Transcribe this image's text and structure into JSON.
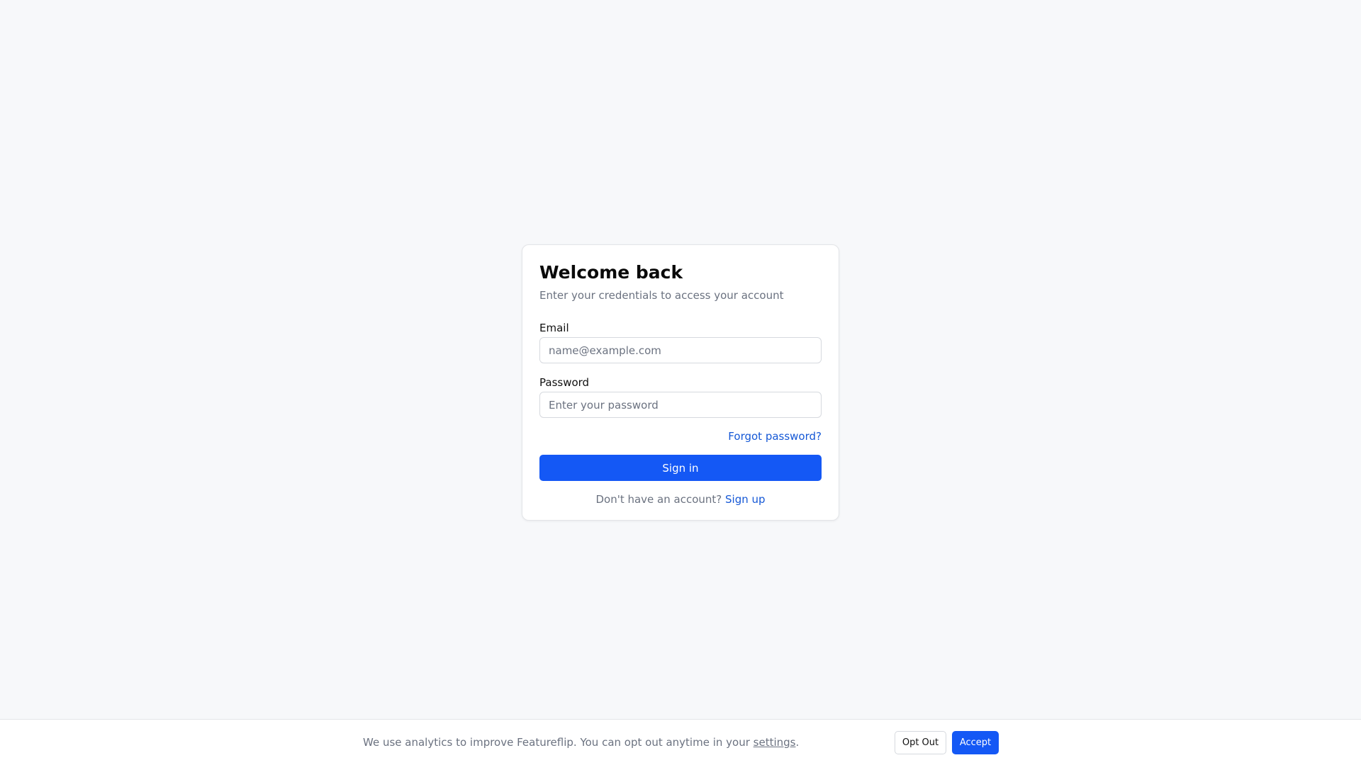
{
  "login": {
    "title": "Welcome back",
    "subtitle": "Enter your credentials to access your account",
    "email_label": "Email",
    "email_placeholder": "name@example.com",
    "email_value": "",
    "password_label": "Password",
    "password_placeholder": "Enter your password",
    "password_value": "",
    "forgot_label": "Forgot password?",
    "signin_label": "Sign in",
    "signup_prompt": "Don't have an account?",
    "signup_link": "Sign up"
  },
  "consent": {
    "text": "We use analytics to improve Featureflip. You can opt out anytime in your",
    "settings_link": "settings",
    "period": ".",
    "opt_out_label": "Opt Out",
    "accept_label": "Accept"
  },
  "colors": {
    "primary": "#1458f5",
    "link": "#1558d6",
    "background": "#f7f8fa",
    "muted_text": "#6b7280"
  }
}
